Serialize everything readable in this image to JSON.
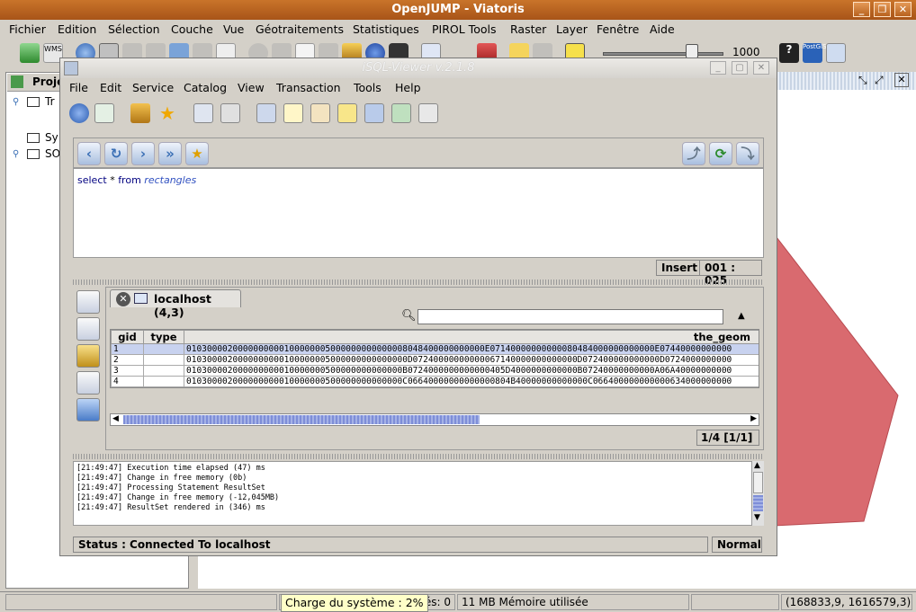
{
  "main_window": {
    "title": "OpenJUMP - Viatoris",
    "menu": [
      "Fichier",
      "Edition",
      "Sélection",
      "Couche",
      "Vue",
      "Géotraitements",
      "Statistiques",
      "PIROL Tools",
      "Raster",
      "Layer",
      "Fenêtre",
      "Aide"
    ],
    "scale_value": "1000",
    "wms_label": "WMS",
    "postgis_label": "PostGIS"
  },
  "project_panel": {
    "header_label": "Proje",
    "tree_items": [
      "Tr",
      "Sy",
      "SO"
    ]
  },
  "isql": {
    "title": "iSQL-Viewer v.2.1.8",
    "menu": [
      "File",
      "Edit",
      "Service",
      "Catalog",
      "View",
      "Transaction",
      "Tools",
      "Help"
    ],
    "query": {
      "kw1": "select",
      "star": "*",
      "kw2": "from",
      "table": "rectangles"
    },
    "editor_mode": "Insert",
    "cursor_pos": "001 : 025",
    "result_tab": "localhost (4,3)",
    "columns": [
      "gid",
      "type",
      "the_geom"
    ],
    "rows": [
      {
        "gid": "1",
        "type": "",
        "geom": "0103000020000000000100000005000000000000008048400000000000E07140000000000080484000000000000E07440000000000"
      },
      {
        "gid": "2",
        "type": "",
        "geom": "0103000020000000000100000005000000000000000D07240000000000067140000000000000D072400000000000D0724000000000"
      },
      {
        "gid": "3",
        "type": "",
        "geom": "010300002000000000010000000500000000000000B0724000000000000405D4000000000000B07240000000000A06A40000000000"
      },
      {
        "gid": "4",
        "type": "",
        "geom": "010300002000000000010000000500000000000000C06640000000000000804B40000000000000C066400000000000634000000000"
      }
    ],
    "page_info": "1/4 [1/1]",
    "log": [
      "[21:49:47] Execution time elapsed (47) ms",
      "[21:49:47] Change in free memory (0b)",
      "[21:49:47] Processing Statement ResultSet",
      "[21:49:47] Change in free memory (-12,045MB)",
      "[21:49:47] ResultSet rendered in (346) ms"
    ],
    "status_text": "Status : Connected To localhost",
    "status_mode": "Normal"
  },
  "statusbar": {
    "features": "és: 0",
    "memory": "11 MB Mémoire utilisée",
    "coords": "(168833,9, 1616579,3)",
    "tooltip": "Charge du système : 2%"
  },
  "colors": {
    "titlebar": "#b8621e",
    "polygon_fill": "#d96a6f",
    "selection_row": "#c8d2ef"
  }
}
